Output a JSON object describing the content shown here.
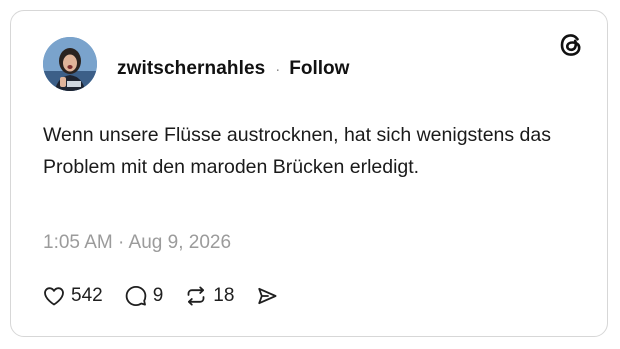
{
  "post": {
    "username": "zwitschernahles",
    "separator": "·",
    "follow_label": "Follow",
    "text": "Wenn unsere Flüsse austrocknen, hat sich wenigstens das Problem mit den maroden Brücken erledigt.",
    "timestamp": "1:05 AM · Aug 9, 2026"
  },
  "actions": {
    "likes": "542",
    "replies": "9",
    "reposts": "18"
  },
  "icons": {
    "brand": "threads-logo-icon",
    "like": "heart-icon",
    "reply": "speech-bubble-icon",
    "repost": "repost-icon",
    "share": "send-icon"
  },
  "colors": {
    "text": "#111111",
    "muted": "#9b9b9b",
    "border": "#d7d7d7"
  }
}
